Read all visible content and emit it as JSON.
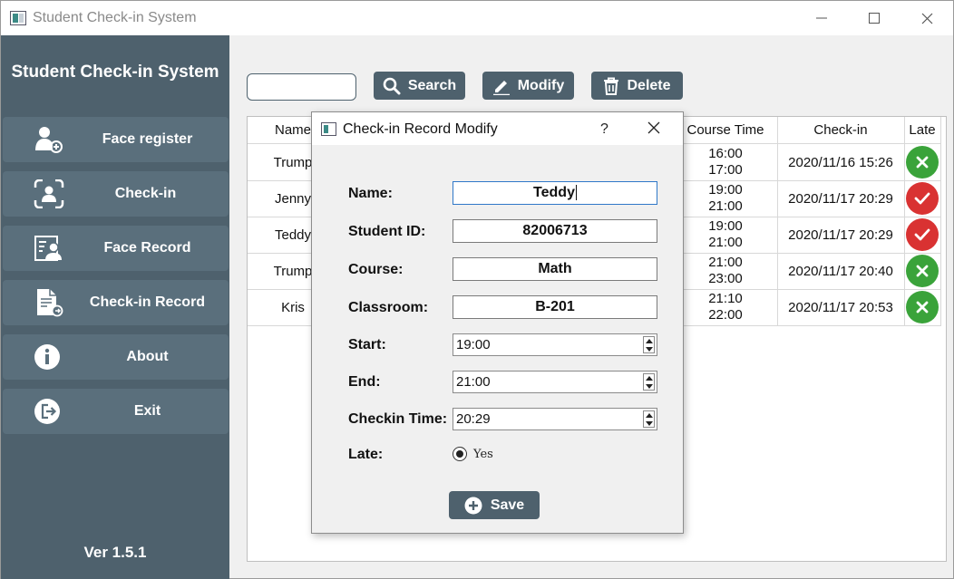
{
  "window": {
    "title": "Student Check-in System"
  },
  "sidebar": {
    "title": "Student Check-in System",
    "items": [
      {
        "label": "Face register",
        "icon": "user-add-icon"
      },
      {
        "label": "Check-in",
        "icon": "face-scan-icon"
      },
      {
        "label": "Face Record",
        "icon": "face-record-icon"
      },
      {
        "label": "Check-in Record",
        "icon": "document-icon"
      },
      {
        "label": "About",
        "icon": "info-icon"
      },
      {
        "label": "Exit",
        "icon": "exit-icon"
      }
    ],
    "version": "Ver 1.5.1"
  },
  "toolbar": {
    "search_value": "",
    "search_label": "Search",
    "modify_label": "Modify",
    "delete_label": "Delete"
  },
  "table": {
    "headers": {
      "name": "Name",
      "course_time": "Course Time",
      "checkin": "Check-in",
      "late": "Late"
    },
    "rows": [
      {
        "name": "Trump",
        "start": "16:00",
        "end": "17:00",
        "checkin": "2020/11/16 15:26",
        "late": false
      },
      {
        "name": "Jenny",
        "start": "19:00",
        "end": "21:00",
        "checkin": "2020/11/17 20:29",
        "late": true
      },
      {
        "name": "Teddy",
        "start": "19:00",
        "end": "21:00",
        "checkin": "2020/11/17 20:29",
        "late": true
      },
      {
        "name": "Trump",
        "start": "21:00",
        "end": "23:00",
        "checkin": "2020/11/17 20:40",
        "late": false
      },
      {
        "name": "Kris",
        "start": "21:10",
        "end": "22:00",
        "checkin": "2020/11/17 20:53",
        "late": false
      }
    ]
  },
  "dialog": {
    "title": "Check-in Record Modify",
    "help": "?",
    "fields": {
      "name_label": "Name:",
      "name_value": "Teddy",
      "id_label": "Student ID:",
      "id_value": "82006713",
      "course_label": "Course:",
      "course_value": "Math",
      "classroom_label": "Classroom:",
      "classroom_value": "B-201",
      "start_label": "Start:",
      "start_value": "19:00",
      "end_label": "End:",
      "end_value": "21:00",
      "checkin_label": "Checkin Time:",
      "checkin_value": "20:29",
      "late_label": "Late:",
      "late_option": "Yes"
    },
    "save_label": "Save"
  },
  "colors": {
    "sidebar": "#4e616d",
    "button": "#5a6f7c",
    "ok": "#3aa33a",
    "late": "#d93232"
  }
}
